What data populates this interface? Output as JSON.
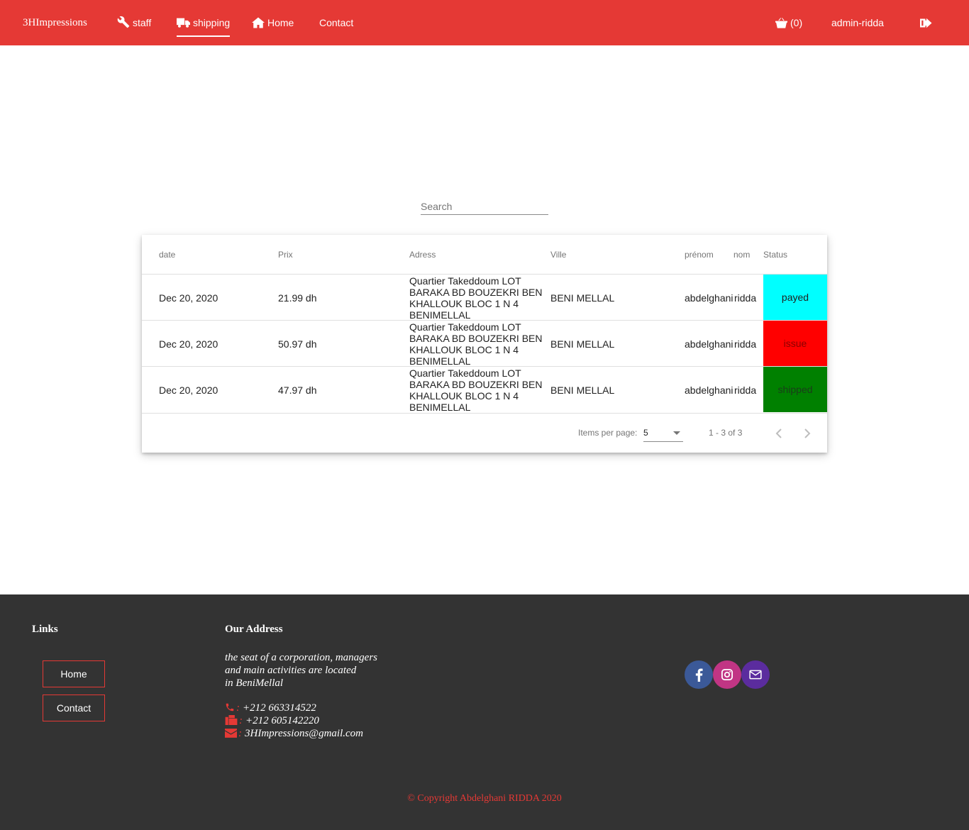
{
  "nav": {
    "brand": "3HImpressions",
    "staff": "staff",
    "shipping": "shipping",
    "home": "Home",
    "contact": "Contact",
    "cart": "(0)",
    "user": "admin-ridda"
  },
  "search": {
    "placeholder": "Search"
  },
  "table": {
    "headers": [
      "date",
      "Prix",
      "Adress",
      "Ville",
      "prénom",
      "nom",
      "Status"
    ],
    "rows": [
      {
        "date": "Dec 20, 2020",
        "prix": "21.99 dh",
        "adress": "Quartier Takeddoum LOT BARAKA BD BOUZEKRI BEN KHALLOUK BLOC 1 N 4 BENIMELLAL",
        "ville": "BENI MELLAL",
        "prenom": "abdelghani",
        "nom": "ridda",
        "status": "payed",
        "status_color": "#00ffff",
        "status_text_color": "#212121"
      },
      {
        "date": "Dec 20, 2020",
        "prix": "50.97 dh",
        "adress": "Quartier Takeddoum LOT BARAKA BD BOUZEKRI BEN KHALLOUK BLOC 1 N 4 BENIMELLAL",
        "ville": "BENI MELLAL",
        "prenom": "abdelghani",
        "nom": "ridda",
        "status": "issue",
        "status_color": "#ff0000",
        "status_text_color": "#8b0000"
      },
      {
        "date": "Dec 20, 2020",
        "prix": "47.97 dh",
        "adress": "Quartier Takeddoum LOT BARAKA BD BOUZEKRI BEN KHALLOUK BLOC 1 N 4 BENIMELLAL",
        "ville": "BENI MELLAL",
        "prenom": "abdelghani",
        "nom": "ridda",
        "status": "shipped",
        "status_color": "#008000",
        "status_text_color": "#1a3d1a"
      }
    ],
    "paginator": {
      "items_label": "Items per page:",
      "page_size": "5",
      "range": "1 - 3 of 3"
    }
  },
  "footer": {
    "links_title": "Links",
    "links": [
      "Home",
      "Contact"
    ],
    "address_title": "Our Address",
    "address_lines": [
      "the seat of a corporation, managers",
      "and main activities are located",
      "in BeniMellal"
    ],
    "phone": "+212 663314522",
    "fax": "+212 605142220",
    "email": "3HImpressions@gmail.com",
    "sep": ":",
    "copyright": "© Copyright Abdelghani RIDDA 2020"
  },
  "colors": {
    "brand": "#e53935",
    "footer_bg": "#333333",
    "facebook": "#3b5998",
    "instagram": "#c13584",
    "email": "#5b2c9e"
  },
  "icons": {
    "staff": "wrench-icon",
    "shipping": "truck-icon",
    "home": "home-icon",
    "cart": "basket-icon",
    "logout": "logout-icon",
    "phone": "phone-icon",
    "fax": "fax-icon",
    "email": "envelope-icon",
    "social": [
      "facebook-icon",
      "instagram-icon",
      "envelope-icon"
    ]
  }
}
